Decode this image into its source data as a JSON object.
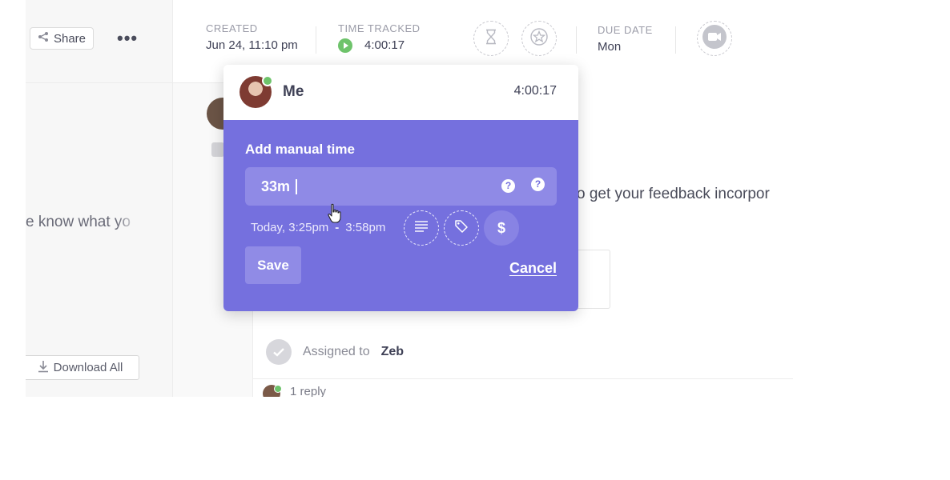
{
  "toolbar": {
    "share_label": "Share",
    "more_label": "•••",
    "download_all_label": "Download All"
  },
  "left_panel": {
    "snippet": "e know what yo"
  },
  "task_meta": {
    "created_label": "CREATED",
    "created_value": "Jun 24, 11:10 pm",
    "time_tracked_label": "TIME TRACKED",
    "time_tracked_value": "4:00:17",
    "due_date_label": "DUE DATE",
    "due_date_value": "Mon"
  },
  "content": {
    "line_text": "o get your feedback incorpor",
    "assigned_prefix": "Assigned to",
    "assigned_name": "Zeb",
    "reply_label": "1 reply"
  },
  "time_popup": {
    "user_name": "Me",
    "user_total": "4:00:17",
    "section_title": "Add manual time",
    "input_value": "33m",
    "help_icon_label": "?",
    "range_start": "Today, 3:25pm",
    "range_separator": "-",
    "range_end": "3:58pm",
    "billable_label": "$",
    "save_label": "Save",
    "cancel_label": "Cancel"
  },
  "colors": {
    "popup_body": "#7570de",
    "input_bg": "#8f8ae6",
    "online": "#6ec36b",
    "play": "#6ec36b"
  },
  "icons": [
    "share-icon",
    "play-icon",
    "hourglass-icon",
    "star-icon",
    "video-camera-icon",
    "download-icon",
    "question-icon",
    "notes-icon",
    "tag-icon",
    "dollar-icon",
    "check-icon",
    "hand-cursor-icon"
  ]
}
